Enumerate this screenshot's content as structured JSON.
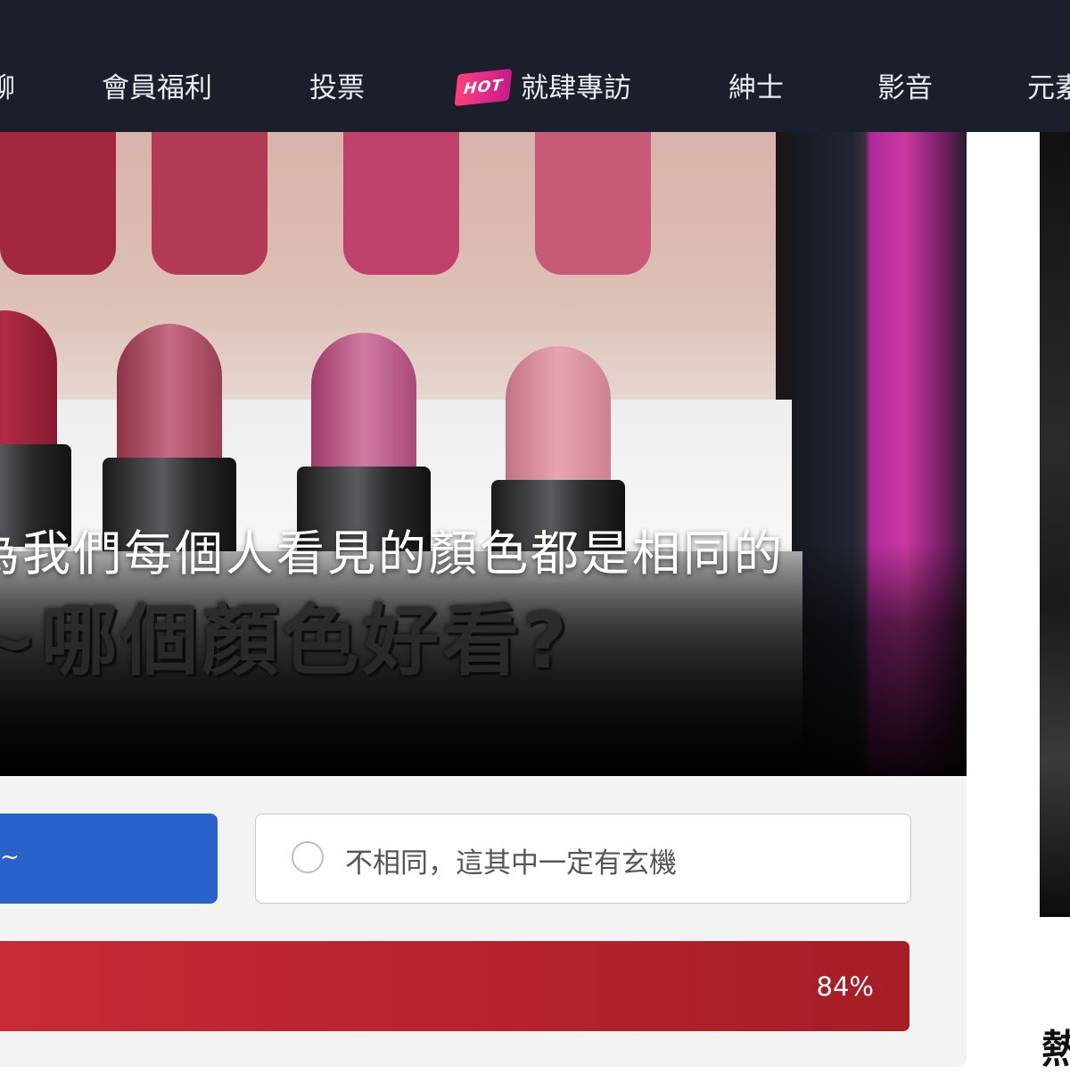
{
  "nav": {
    "items": [
      "聊",
      "會員福利",
      "投票",
      "就肆專訪",
      "紳士",
      "影音",
      "元素"
    ],
    "hot_badge": "HOT"
  },
  "hero": {
    "title": "為我們每個人看見的顏色都是相同的",
    "image_caption": "~哪個顏色好看?"
  },
  "poll": {
    "selected_option": "~",
    "other_option": "不相同，這其中一定有玄機",
    "result_percent": "84%",
    "result_value": 0.84
  },
  "sidebar": {
    "heading": "熱"
  },
  "colors": {
    "nav_bg": "#1a1f2b",
    "selected_blue": "#2a62cc",
    "result_red": "#b5222c",
    "card_bg": "#f3f3f4",
    "hot_pink": "#ff3e7f"
  }
}
